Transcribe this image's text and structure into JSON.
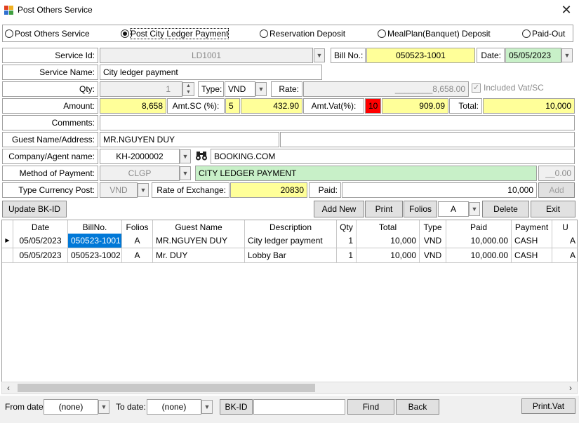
{
  "window": {
    "title": "Post Others Service",
    "close_glyph": "✕"
  },
  "radio_options": [
    {
      "label": "Post Others Service",
      "selected": false
    },
    {
      "label": "Post City Ledger Payment",
      "selected": true
    },
    {
      "label": "Reservation Deposit",
      "selected": false
    },
    {
      "label": "MealPlan(Banquet) Deposit",
      "selected": false
    },
    {
      "label": "Paid-Out",
      "selected": false
    }
  ],
  "form": {
    "service_id_label": "Service Id:",
    "service_id_value": "LD1001",
    "bill_no_label": "Bill No.:",
    "bill_no_value": "050523-1001",
    "date_label": "Date:",
    "date_value": "05/05/2023",
    "service_name_label": "Service Name:",
    "service_name_value": "City ledger payment",
    "qty_label": "Qty:",
    "qty_value": "1",
    "type_label": "Type:",
    "type_value": "VND",
    "rate_label": "Rate:",
    "rate_value": "________8,658.00",
    "included_vat_label": "Included Vat/SC",
    "amount_label": "Amount:",
    "amount_value": "8,658",
    "amt_sc_label": "Amt.SC (%):",
    "amt_sc_pct": "5",
    "amt_sc_value": "432.90",
    "amt_vat_label": "Amt.Vat(%):",
    "amt_vat_pct": "10",
    "amt_vat_value": "909.09",
    "total_label": "Total:",
    "total_value": "10,000",
    "comments_label": "Comments:",
    "comments_value": "",
    "guest_label": "Guest Name/Address:",
    "guest_name_value": "MR.NGUYEN DUY",
    "guest_address_value": "",
    "company_label": "Company/Agent name:",
    "company_code_value": "KH-2000002",
    "company_name_value": "BOOKING.COM",
    "method_label": "Method of Payment:",
    "method_code_value": "CLGP",
    "method_name_value": "CITY LEDGER PAYMENT",
    "method_amount_value": "__0.00",
    "currency_label": "Type Currency Post:",
    "currency_value": "VND",
    "exchange_label": "Rate of Exchange:",
    "exchange_value": "20830",
    "paid_label": "Paid:",
    "paid_value": "10,000",
    "add_label": "Add"
  },
  "toolbar": {
    "update_bk_label": "Update BK-ID",
    "add_new_label": "Add New",
    "print_label": "Print",
    "folios_label": "Folios",
    "folio_value": "A",
    "delete_label": "Delete",
    "exit_label": "Exit"
  },
  "table": {
    "columns": [
      "Date",
      "BillNo.",
      "Folios",
      "Guest Name",
      "Description",
      "Qty",
      "Total",
      "Type",
      "Paid",
      "Payment",
      "U"
    ],
    "rows": [
      [
        "05/05/2023",
        "050523-1001",
        "A",
        "MR.NGUYEN DUY",
        "City ledger payment",
        "1",
        "10,000",
        "VND",
        "10,000.00",
        "CASH",
        "A"
      ],
      [
        "05/05/2023",
        "050523-1002",
        "A",
        "Mr. DUY",
        "Lobby Bar",
        "1",
        "10,000",
        "VND",
        "10,000.00",
        "CASH",
        "A"
      ]
    ]
  },
  "filters": {
    "from_date_label": "From date:",
    "from_date_value": "(none)",
    "to_date_label": "To date:",
    "to_date_value": "(none)",
    "bk_id_label": "BK-ID",
    "bk_id_value": "",
    "find_label": "Find",
    "back_label": "Back",
    "print_vat_label": "Print.Vat"
  },
  "colors": {
    "highlight_yellow": "#ffff99",
    "highlight_green": "#c8f0c8",
    "vat_red": "#ff0000",
    "selection_blue": "#0078d7"
  }
}
